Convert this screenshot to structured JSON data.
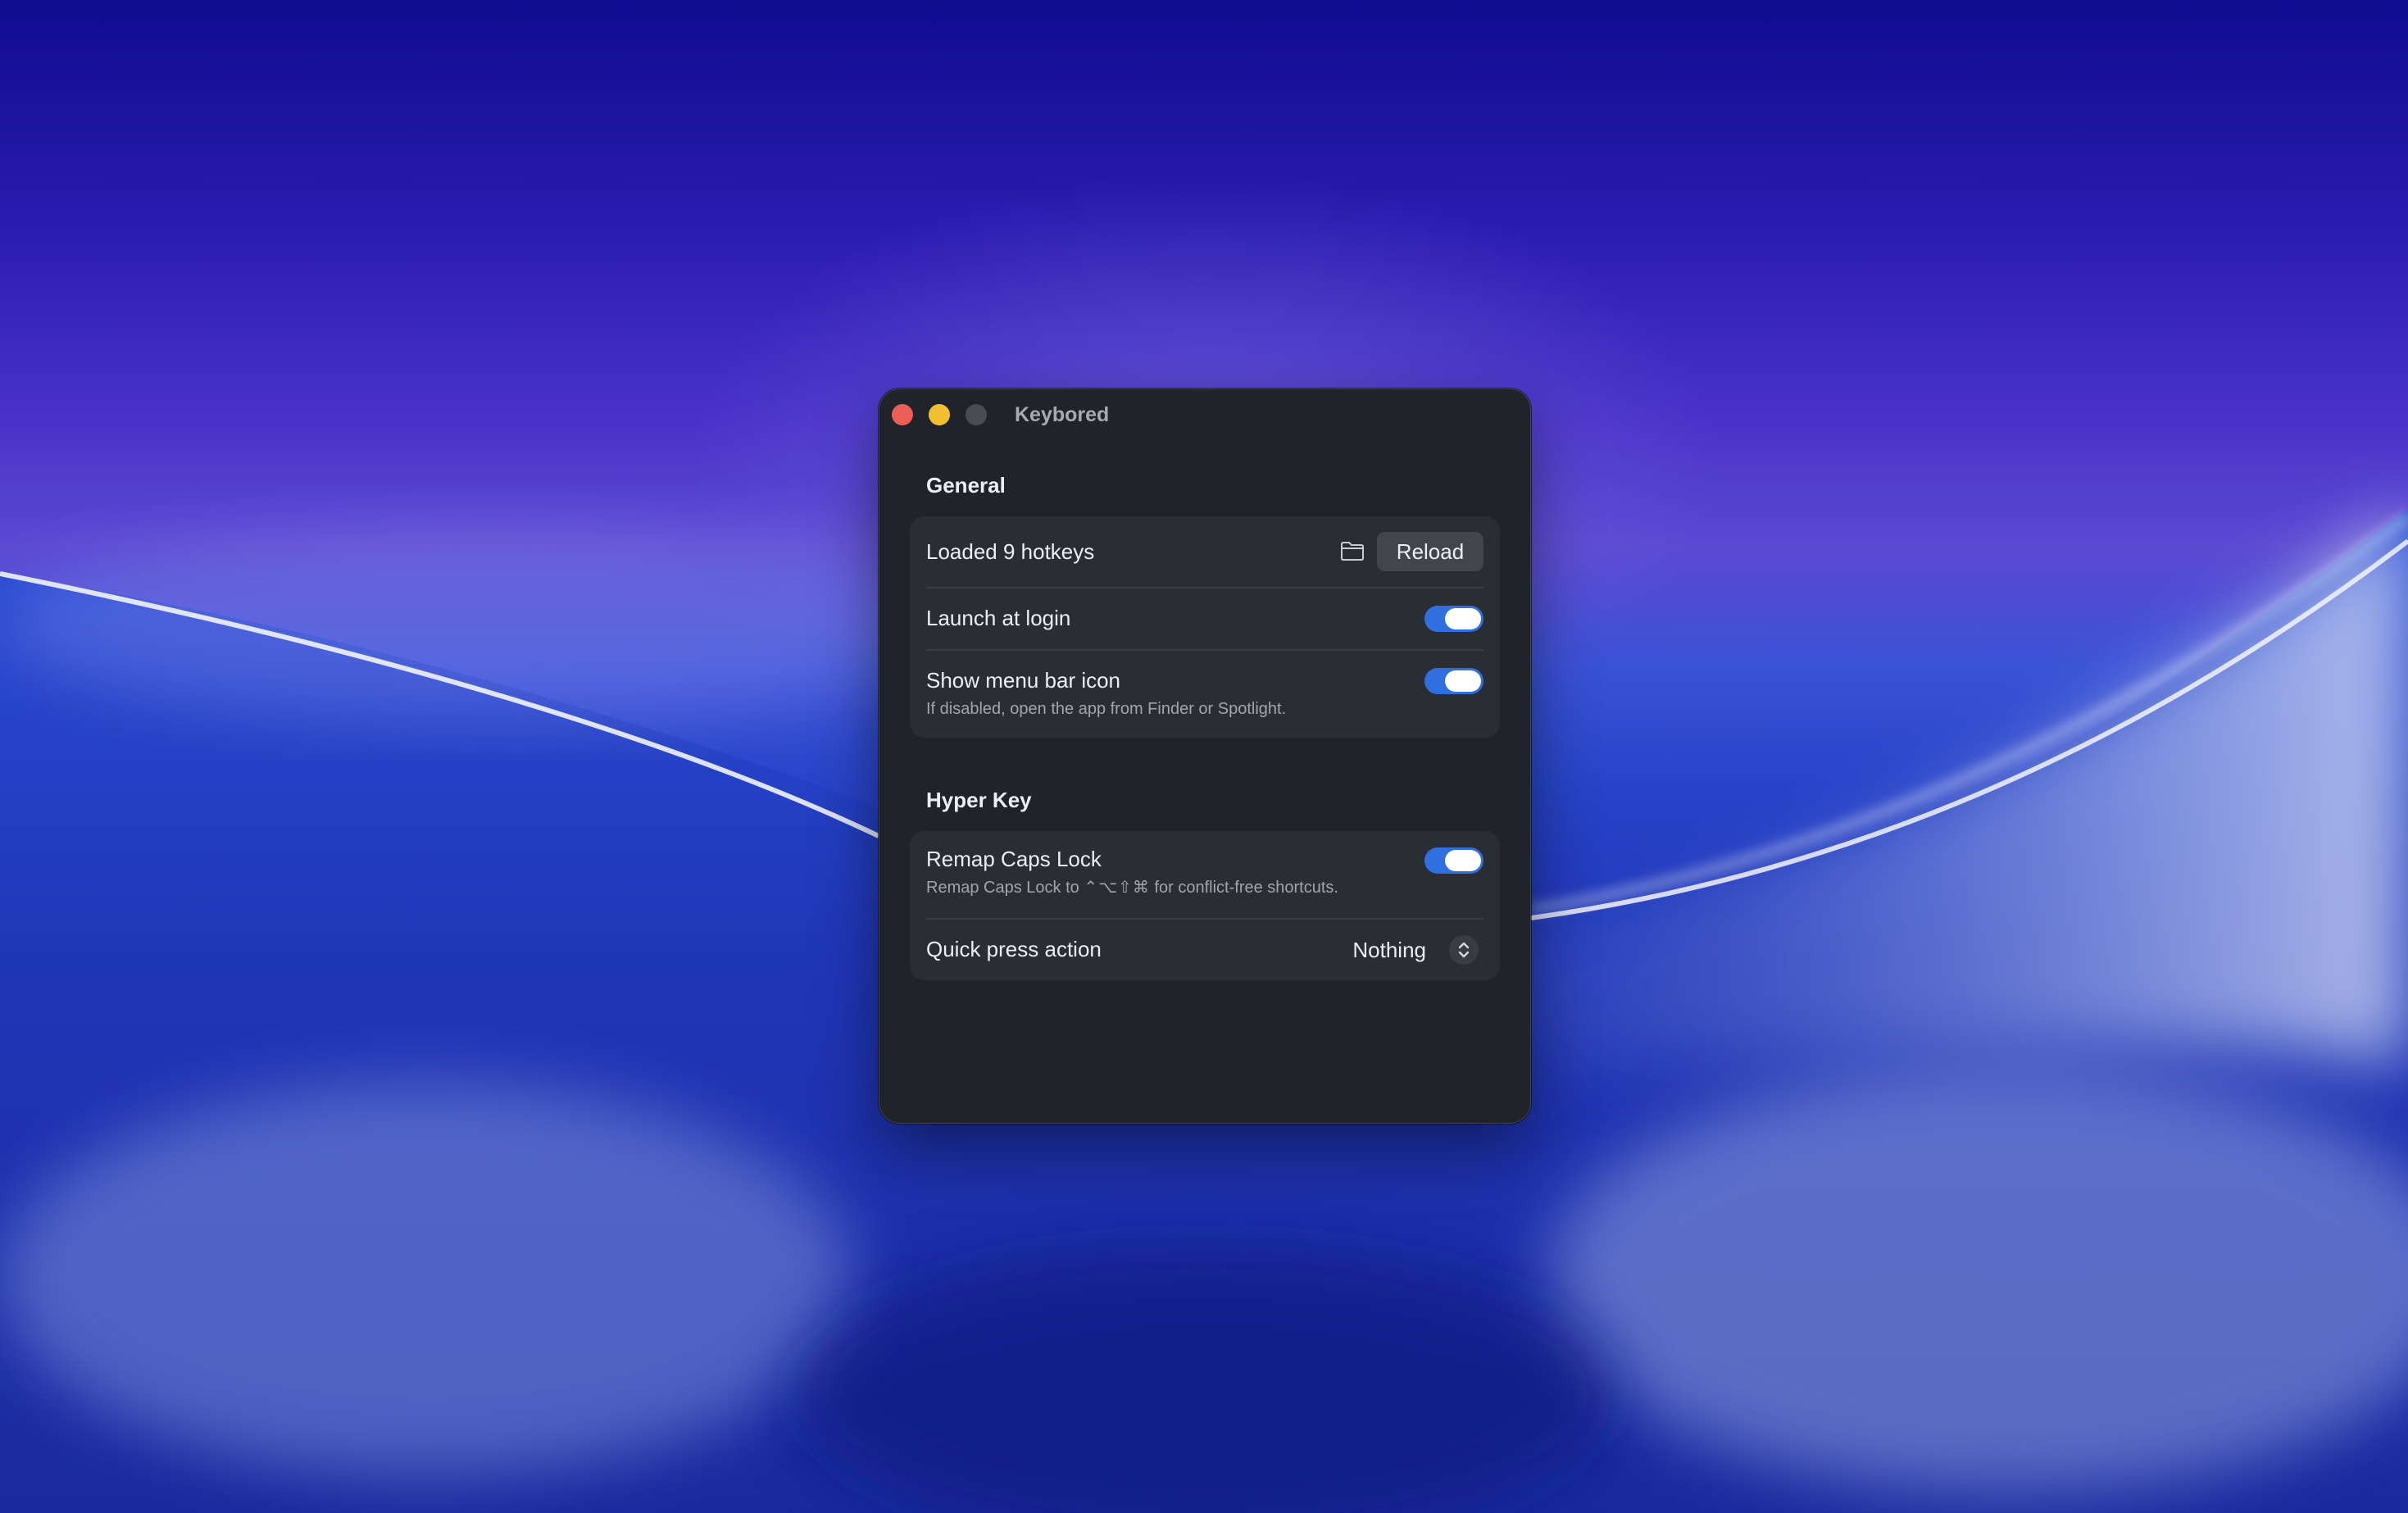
{
  "window": {
    "title": "Keybored"
  },
  "general": {
    "heading": "General",
    "hotkeys_status": "Loaded 9 hotkeys",
    "folder_icon": "folder-icon",
    "reload_label": "Reload",
    "launch_at_login": {
      "label": "Launch at login",
      "enabled": true
    },
    "show_menu_bar_icon": {
      "label": "Show menu bar icon",
      "description": "If disabled, open the app from Finder or Spotlight.",
      "enabled": true
    }
  },
  "hyper_key": {
    "heading": "Hyper Key",
    "remap_caps_lock": {
      "label": "Remap Caps Lock",
      "description_prefix": "Remap Caps Lock to",
      "modifier_symbols": "⌃⌥⇧⌘",
      "description_suffix": "for conflict-free shortcuts.",
      "enabled": true
    },
    "quick_press_action": {
      "label": "Quick press action",
      "selected": "Nothing"
    }
  },
  "colors": {
    "accent": "#2f6fe0",
    "window_bg": "#21232a",
    "group_bg": "#2b2d34",
    "traffic_close": "#ec5f58",
    "traffic_minimize": "#f2bf2e"
  }
}
